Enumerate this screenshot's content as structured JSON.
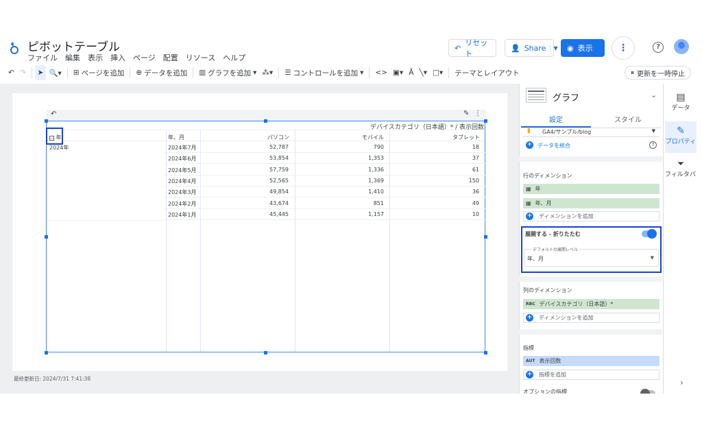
{
  "app": {
    "title": "ピボットテーブル",
    "menu": [
      "ファイル",
      "編集",
      "表示",
      "挿入",
      "ページ",
      "配置",
      "リソース",
      "ヘルプ"
    ],
    "buttons": {
      "reset": "リセット",
      "share": "Share",
      "view": "表示"
    }
  },
  "toolbar": {
    "add_page": "ページを追加",
    "add_data": "データを追加",
    "add_chart": "グラフを追加",
    "add_control": "コントロールを追加",
    "theme_layout": "テーマとレイアウト",
    "pause_update": "更新を一時停止"
  },
  "report": {
    "column_header": "デバイスカテゴリ（日本語）* / 表示回数",
    "row_dim_label": "年",
    "row_dim2_label": "年、月",
    "year_value": "2024年",
    "columns": [
      "パソコン",
      "モバイル",
      "タブレット"
    ],
    "rows": [
      {
        "month": "2024年7月",
        "pc": "52,787",
        "mobile": "790",
        "tablet": "18"
      },
      {
        "month": "2024年6月",
        "pc": "53,854",
        "mobile": "1,353",
        "tablet": "37"
      },
      {
        "month": "2024年5月",
        "pc": "57,759",
        "mobile": "1,336",
        "tablet": "61"
      },
      {
        "month": "2024年4月",
        "pc": "52,565",
        "mobile": "1,369",
        "tablet": "150"
      },
      {
        "month": "2024年3月",
        "pc": "49,854",
        "mobile": "1,410",
        "tablet": "36"
      },
      {
        "month": "2024年2月",
        "pc": "43,674",
        "mobile": "851",
        "tablet": "49"
      },
      {
        "month": "2024年1月",
        "pc": "45,445",
        "mobile": "1,157",
        "tablet": "10"
      }
    ],
    "last_updated": "最終更新日: 2024/7/31 7:41:38"
  },
  "panel": {
    "title": "グラフ",
    "tabs": [
      "設定",
      "スタイル"
    ],
    "data_source": "GA4/サンプル/blog",
    "merge_data": "データを統合",
    "row_dimensions_label": "行のディメンション",
    "row_dimensions": [
      "年",
      "年、月"
    ],
    "add_dimension": "ディメンションを追加",
    "expand_label": "展開する - 折りたたむ",
    "default_expand_level_label": "デフォルトの展開レベル",
    "default_expand_level_value": "年、月",
    "col_dimensions_label": "列のディメンション",
    "col_dimension": "デバイスカテゴリ（日本語）*",
    "col_dim_type": "RBC",
    "metrics_label": "指標",
    "metric": "表示回数",
    "metric_type": "AUT",
    "add_metric": "指標を追加",
    "optional_metrics": "オプションの指標"
  },
  "rail": [
    "データ",
    "プロパティ",
    "フィルタバー"
  ]
}
